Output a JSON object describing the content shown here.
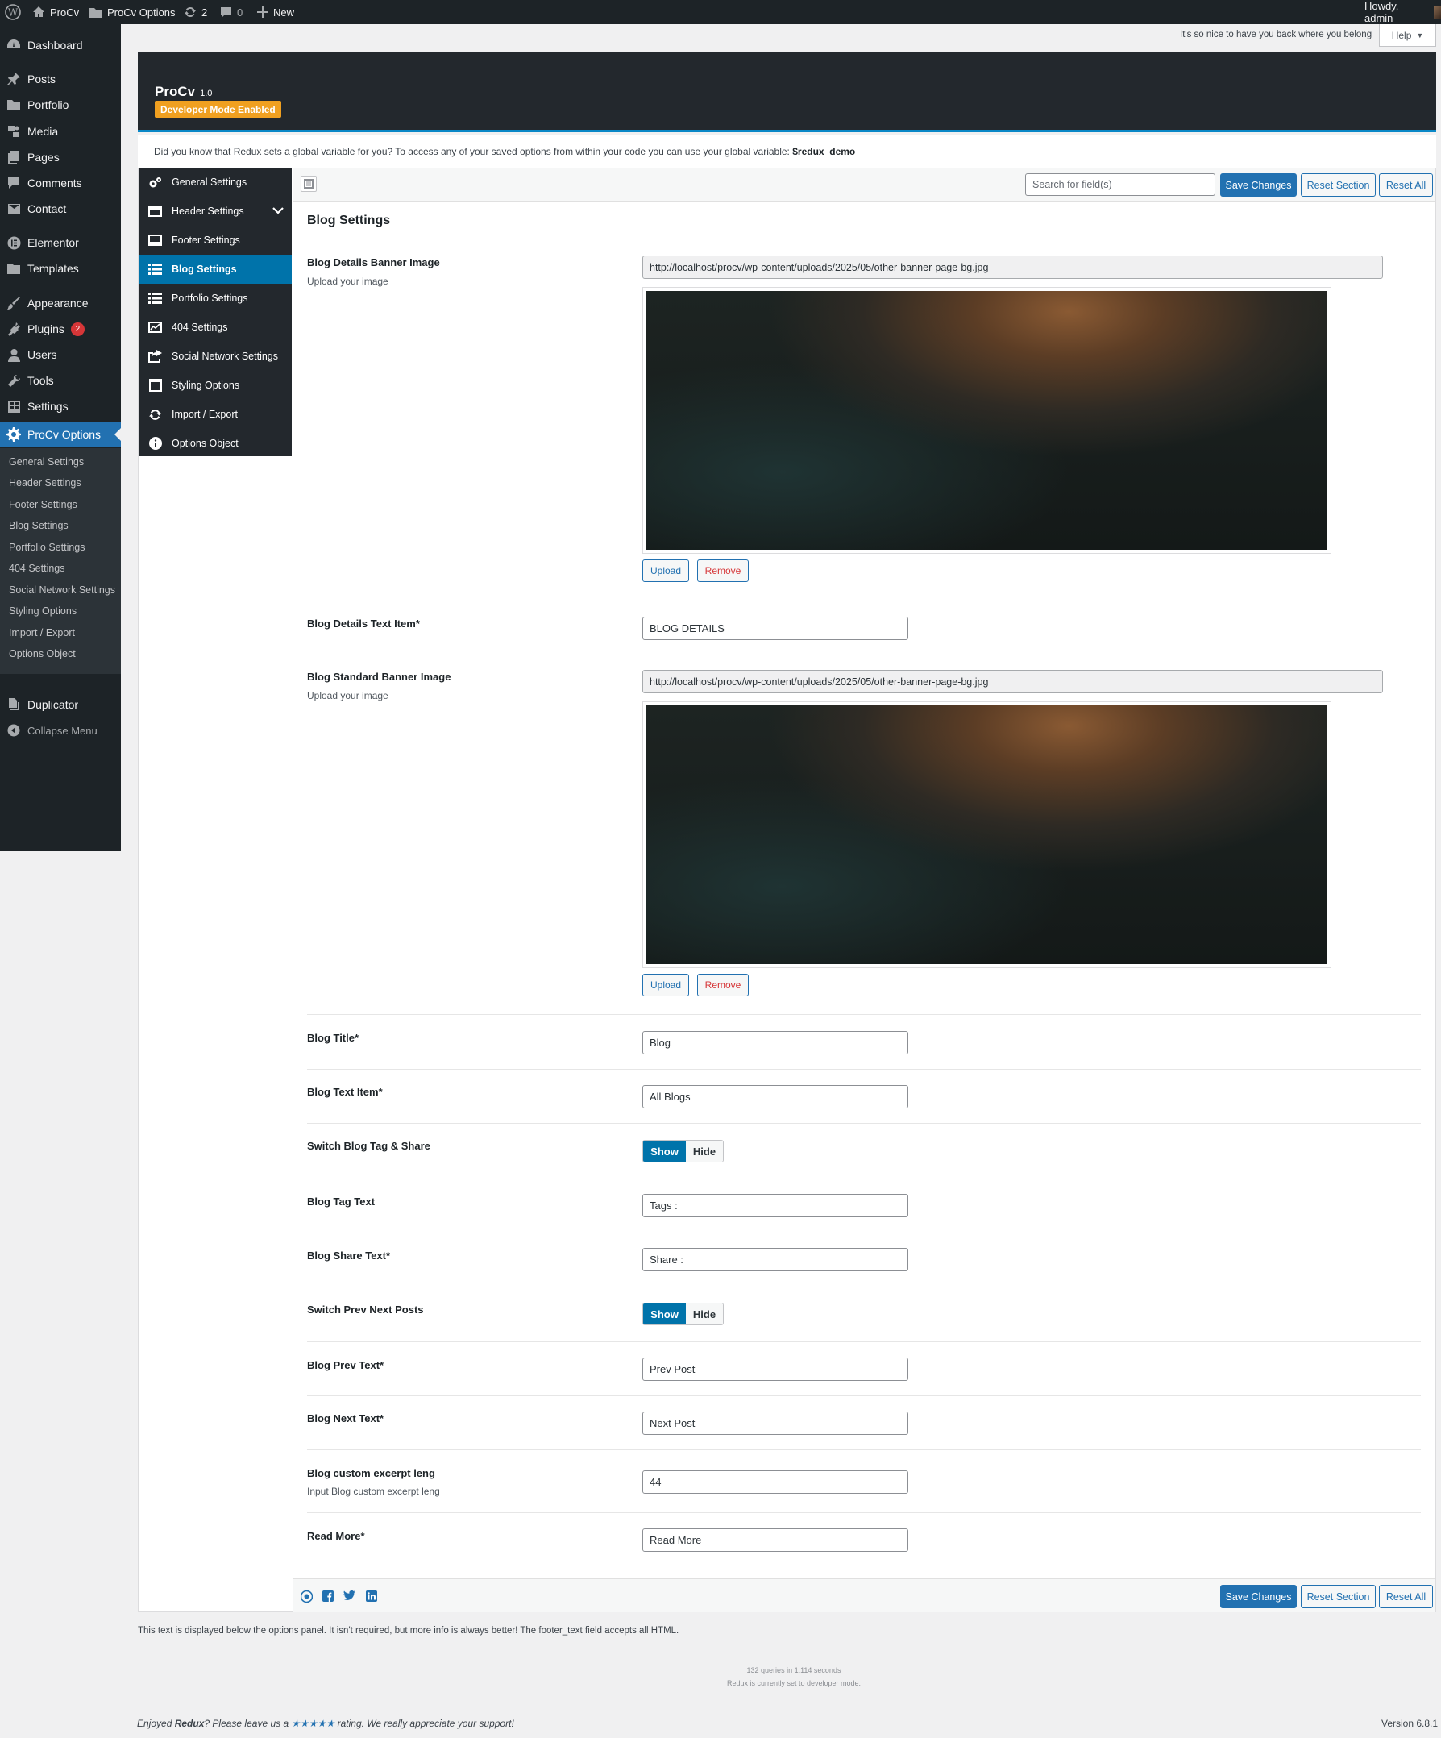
{
  "adminbar": {
    "site_name": "ProCv",
    "options_link": "ProCv Options",
    "updates_count": "2",
    "comments_count": "0",
    "new_label": "New",
    "howdy": "Howdy, admin"
  },
  "admin_menu": {
    "items": [
      {
        "label": "Dashboard",
        "icon": "dashboard-icon"
      },
      {
        "label": "Posts",
        "icon": "pin-icon"
      },
      {
        "label": "Portfolio",
        "icon": "folder-icon"
      },
      {
        "label": "Media",
        "icon": "media-icon"
      },
      {
        "label": "Pages",
        "icon": "pages-icon"
      },
      {
        "label": "Comments",
        "icon": "comment-icon"
      },
      {
        "label": "Contact",
        "icon": "mail-icon"
      },
      {
        "label": "Elementor",
        "icon": "elementor-icon"
      },
      {
        "label": "Templates",
        "icon": "folder-icon"
      },
      {
        "label": "Appearance",
        "icon": "brush-icon"
      },
      {
        "label": "Plugins",
        "icon": "plugin-icon",
        "badge": "2"
      },
      {
        "label": "Users",
        "icon": "user-icon"
      },
      {
        "label": "Tools",
        "icon": "wrench-icon"
      },
      {
        "label": "Settings",
        "icon": "settings-icon"
      },
      {
        "label": "ProCv Options",
        "icon": "gear-icon",
        "current": true
      },
      {
        "label": "Duplicator",
        "icon": "duplicator-icon"
      },
      {
        "label": "Collapse Menu",
        "icon": "collapse-icon"
      }
    ],
    "submenu": [
      "General Settings",
      "Header Settings",
      "Footer Settings",
      "Blog Settings",
      "Portfolio Settings",
      "404 Settings",
      "Social Network Settings",
      "Styling Options",
      "Import / Export",
      "Options Object"
    ]
  },
  "top": {
    "welcome": "It's so nice to have you back where you belong",
    "help": "Help"
  },
  "header": {
    "app_name": "ProCv",
    "version": "1.0",
    "dev_mode": "Developer Mode Enabled"
  },
  "notice": {
    "text": "Did you know that Redux sets a global variable for you? To access any of your saved options from within your code you can use your global variable: ",
    "var": "$redux_demo"
  },
  "section_nav": [
    {
      "label": "General Settings",
      "icon": "gears-icon"
    },
    {
      "label": "Header Settings",
      "icon": "header-icon"
    },
    {
      "label": "Footer Settings",
      "icon": "footer-icon"
    },
    {
      "label": "Blog Settings",
      "icon": "list-icon",
      "active": true
    },
    {
      "label": "Portfolio Settings",
      "icon": "list-icon"
    },
    {
      "label": "404 Settings",
      "icon": "chart-icon"
    },
    {
      "label": "Social Network Settings",
      "icon": "share-icon"
    },
    {
      "label": "Styling Options",
      "icon": "window-icon"
    },
    {
      "label": "Import / Export",
      "icon": "refresh-icon"
    },
    {
      "label": "Options Object",
      "icon": "info-icon"
    }
  ],
  "toolbar": {
    "search_placeholder": "Search for field(s)",
    "save": "Save Changes",
    "reset_section": "Reset Section",
    "reset_all": "Reset All"
  },
  "section_title": "Blog Settings",
  "fields": {
    "details_banner": {
      "label": "Blog Details Banner Image",
      "desc": "Upload your image",
      "value": "http://localhost/procv/wp-content/uploads/2025/05/other-banner-page-bg.jpg",
      "upload": "Upload",
      "remove": "Remove"
    },
    "details_text": {
      "label": "Blog Details Text Item*",
      "value": "BLOG DETAILS"
    },
    "standard_banner": {
      "label": "Blog Standard Banner Image",
      "desc": "Upload your image",
      "value": "http://localhost/procv/wp-content/uploads/2025/05/other-banner-page-bg.jpg",
      "upload": "Upload",
      "remove": "Remove"
    },
    "blog_title": {
      "label": "Blog Title*",
      "value": "Blog"
    },
    "blog_text": {
      "label": "Blog Text Item*",
      "value": "All Blogs"
    },
    "switch_tag_share": {
      "label": "Switch Blog Tag & Share",
      "on": "Show",
      "off": "Hide",
      "selected": "Show"
    },
    "tag_text": {
      "label": "Blog Tag Text",
      "value": "Tags :"
    },
    "share_text": {
      "label": "Blog Share Text*",
      "value": "Share :"
    },
    "switch_prev_next": {
      "label": "Switch Prev Next Posts",
      "on": "Show",
      "off": "Hide",
      "selected": "Show"
    },
    "prev_text": {
      "label": "Blog Prev Text*",
      "value": "Prev Post"
    },
    "next_text": {
      "label": "Blog Next Text*",
      "value": "Next Post"
    },
    "excerpt": {
      "label": "Blog custom excerpt leng",
      "desc": "Input Blog custom excerpt leng",
      "value": "44"
    },
    "read_more": {
      "label": "Read More*",
      "value": "Read More"
    }
  },
  "footer": {
    "note": "This text is displayed below the options panel. It isn't required, but more info is always better! The footer_text field accepts all HTML.",
    "queries": "132 queries in 1.114 seconds",
    "dev_mode_note": "Redux is currently set to developer mode.",
    "enjoyed_pre": "Enjoyed ",
    "enjoyed_brand": "Redux",
    "enjoyed_mid": "? Please leave us a ",
    "stars": "★★★★★",
    "enjoyed_post": " rating. We really appreciate your support!",
    "version": "Version 6.8.1"
  },
  "social_icons": [
    "redux-icon",
    "facebook-icon",
    "twitter-icon",
    "linkedin-icon"
  ],
  "colors": {
    "accent": "#2271b1",
    "nav_active": "#0073aa",
    "dev_badge": "#f0a020",
    "header_bg": "#23282d"
  }
}
